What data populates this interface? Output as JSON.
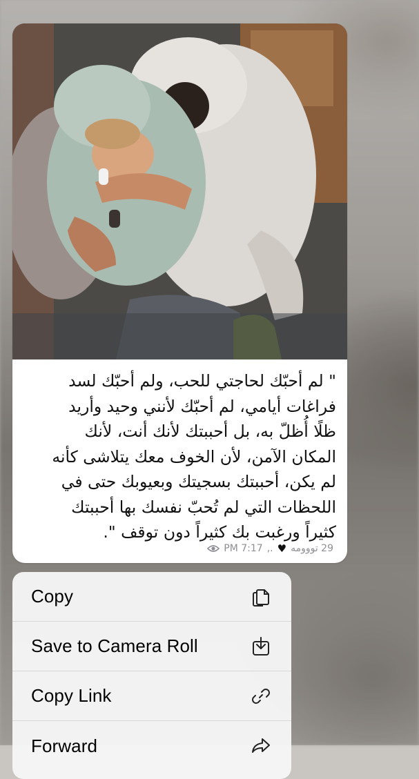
{
  "message": {
    "caption_lines": [
      "\" لم أحبّك لحاجتي للحب، ولم أحبّك لسد",
      "فراغات أيامي، لم أحبّك لأنني وحيد وأريد",
      "ظلًا أُظلّ به، بل أحببتك لأنك أنت، لأنك",
      "المكان الآمن، لأن الخوف معك يتلاشى كأنه",
      "لم يكن، أحببتك بسجيتك وبعيوبك حتى في",
      "اللحظات التي لم تُحبّ نفسك بها أحببتك",
      "كثيراً ورغبت بك كثيراً دون توقف \"."
    ],
    "views": "29 تووومه",
    "author_suffix": ".,",
    "time": "PM 7:17",
    "heart_icon": "black-heart-icon",
    "views_icon": "eye-icon"
  },
  "menu": {
    "items": [
      {
        "label": "Copy",
        "icon": "copy-icon"
      },
      {
        "label": "Save to Camera Roll",
        "icon": "save-download-icon"
      },
      {
        "label": "Copy Link",
        "icon": "link-icon"
      },
      {
        "label": "Forward",
        "icon": "forward-arrow-icon"
      }
    ]
  },
  "colors": {
    "bubble": "#ffffff",
    "menu_bg": "#f6f6f7",
    "meta_text": "#8e8e93",
    "text": "#111111"
  }
}
